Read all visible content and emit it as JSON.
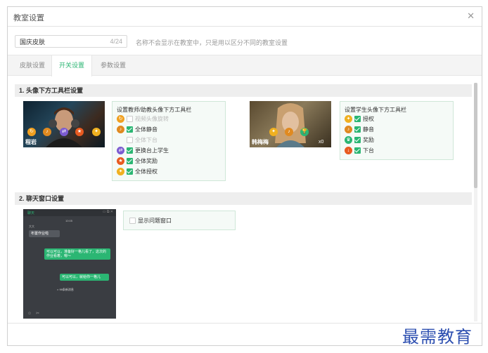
{
  "dialog": {
    "title": "教室设置"
  },
  "name_field": {
    "value": "国庆皮肤",
    "count": "4/24",
    "hint": "名称不会显示在教室中，只是用以区分不同的教室设置"
  },
  "tabs": [
    {
      "label": "皮肤设置"
    },
    {
      "label": "开关设置"
    },
    {
      "label": "参数设置"
    }
  ],
  "section1": {
    "title": "1. 头像下方工具栏设置",
    "teacher_video_name": "程岩",
    "student_video_name": "韩梅梅",
    "student_trophy": "x0",
    "teacher_panel": {
      "title": "设置教师/助教头像下方工具栏",
      "options": [
        {
          "label": "视频头像旋转",
          "checked": false,
          "disabled": true
        },
        {
          "label": "全体静音",
          "checked": true,
          "disabled": false
        },
        {
          "label": "全体下台",
          "checked": false,
          "disabled": true
        },
        {
          "label": "更换台上学生",
          "checked": true,
          "disabled": false
        },
        {
          "label": "全体奖励",
          "checked": true,
          "disabled": false
        },
        {
          "label": "全体授权",
          "checked": true,
          "disabled": false
        }
      ]
    },
    "student_panel": {
      "title": "设置学生头像下方工具栏",
      "options": [
        {
          "label": "授权",
          "checked": true
        },
        {
          "label": "静音",
          "checked": true
        },
        {
          "label": "奖励",
          "checked": true
        },
        {
          "label": "下台",
          "checked": true
        }
      ]
    }
  },
  "section2": {
    "title": "2. 聊天窗口设置",
    "option_label": "显示问题窗口",
    "chat_tab": "聊天",
    "chat_time": "10:05",
    "chat_user": "大大",
    "bubbles": [
      "布置作业啦",
      "可以可以，准备好一格儿看了，这次的作业看着，嗯～",
      "可以可以，就给你一格儿"
    ],
    "system_msg": "× 99条新消息"
  },
  "watermark": "最需教育",
  "colors": {
    "accent": "#2bb673",
    "panel_border": "#cfe7d8"
  }
}
